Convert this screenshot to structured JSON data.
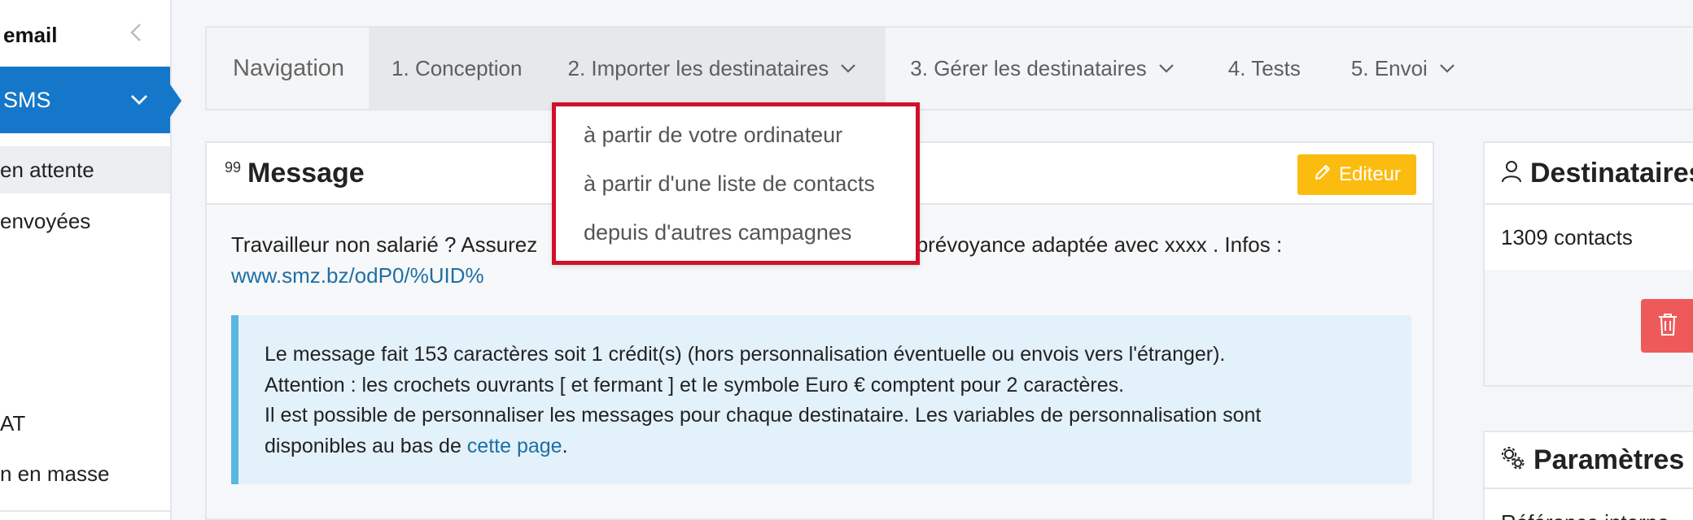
{
  "sidebar": {
    "section_label": "email",
    "active_item": "SMS",
    "sub_items": [
      {
        "label": "en attente"
      },
      {
        "label": "envoyées"
      }
    ],
    "lower_items": [
      {
        "label": "AT"
      },
      {
        "label": "n en masse"
      }
    ]
  },
  "navbar": {
    "title": "Navigation",
    "items": [
      {
        "label": "1. Conception"
      },
      {
        "label": "2. Importer les destinataires"
      },
      {
        "label": "3. Gérer les destinataires"
      },
      {
        "label": "4. Tests"
      },
      {
        "label": "5. Envoi"
      }
    ]
  },
  "dropdown": {
    "items": [
      {
        "label": "à partir de votre ordinateur"
      },
      {
        "label": "à partir d'une liste de contacts"
      },
      {
        "label": "depuis d'autres campagnes"
      }
    ]
  },
  "message": {
    "quote_glyph": "99",
    "title": "Message",
    "edit_button": "Editeur",
    "text_start": "Travailleur non salarié ? Assurez ",
    "text_end": "vec une prévoyance adaptée avec xxxx . Infos :",
    "url": "www.smz.bz/odP0/%UID%",
    "info_line1": "Le message fait 153 caractères soit 1 crédit(s) (hors personnalisation éventuelle ou envois vers l'étranger).",
    "info_line2": "Attention : les crochets ouvrants [ et fermant ] et le symbole Euro € comptent pour 2 caractères.",
    "info_line3": "Il est possible de personnaliser les messages pour chaque destinataire. Les variables de personnalisation sont",
    "info_line4_prefix": "disponibles au bas de ",
    "info_link": "cette page",
    "info_line4_suffix": "."
  },
  "destinataires": {
    "title": "Destinataires",
    "count": "1309 contacts"
  },
  "parametres": {
    "title": "Paramètres",
    "line": "Référence interne"
  },
  "colors": {
    "primary": "#1577c9",
    "warning": "#fbbc0f",
    "danger": "#ee5a5a",
    "highlight_border": "#d0102a",
    "info_bg": "#e3f1fb",
    "info_border": "#5bb7e0",
    "link": "#1d6fa5"
  }
}
